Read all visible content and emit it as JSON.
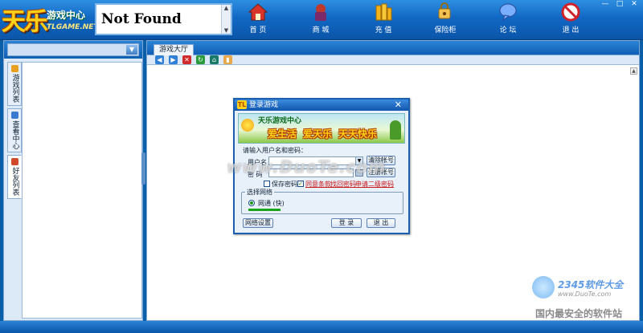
{
  "app": {
    "logo_main": "天乐",
    "logo_sub": "游戏中心",
    "logo_url": "TLGAME.NET",
    "address_text": "Not Found"
  },
  "nav": [
    {
      "key": "home",
      "label": "首 页",
      "icon": "house-icon"
    },
    {
      "key": "mall",
      "label": "商 城",
      "icon": "shopping-bag-icon"
    },
    {
      "key": "recharge",
      "label": "充 值",
      "icon": "coins-icon"
    },
    {
      "key": "safe",
      "label": "保险柜",
      "icon": "safe-lock-icon"
    },
    {
      "key": "forum",
      "label": "论 坛",
      "icon": "chat-bubble-icon"
    },
    {
      "key": "exit",
      "label": "退 出",
      "icon": "no-entry-icon"
    }
  ],
  "window_controls": {
    "minimize": "—",
    "maximize": "□",
    "close": "✕"
  },
  "left_tabs": [
    {
      "label": "游戏列表",
      "color": "#e8a020"
    },
    {
      "label": "查看中心",
      "color": "#3a7ad0"
    },
    {
      "label": "好友列表",
      "color": "#d04a2a"
    }
  ],
  "main": {
    "tab_label": "游戏大厅",
    "toolbar": [
      {
        "name": "back-icon",
        "glyph": "◀",
        "color": "#2f7fd6"
      },
      {
        "name": "forward-icon",
        "glyph": "▶",
        "color": "#2f7fd6"
      },
      {
        "name": "stop-icon",
        "glyph": "✕",
        "color": "#d02a2a"
      },
      {
        "name": "refresh-icon",
        "glyph": "↻",
        "color": "#2a9a3a"
      },
      {
        "name": "home-icon",
        "glyph": "⌂",
        "color": "#1a7a6a"
      },
      {
        "name": "favorites-icon",
        "glyph": "▮",
        "color": "#e8a84a"
      }
    ]
  },
  "dialog": {
    "title": "登录游戏",
    "title_icon": "TL",
    "close": "✕",
    "banner_title": "天乐游戏中心",
    "banner_slogans": [
      "爱生活",
      "爱天乐",
      "天天快乐"
    ],
    "prompt": "请输入用户名和密码：",
    "username_label": "用户名",
    "username_value": "",
    "password_label": "密 码",
    "password_value": "",
    "clear_account_label": "清除帐号",
    "register_label": "注册帐号",
    "save_password_label": "保存密码",
    "save_password_checked": false,
    "agree_terms_label": "同意条款",
    "agree_terms_checked": true,
    "find_password_label": "找回密码",
    "apply_second_password_label": "申请二级密码",
    "network_group_label": "选择网络",
    "network_option": "网通 (快)",
    "network_settings_label": "网络设置",
    "login_label": "登 录",
    "exit_label": "退 出"
  },
  "watermarks": {
    "center": "www.DuoTe.com",
    "corner_brand": "2345软件大全",
    "corner_url": "www.DuoTe.com",
    "corner_slogan": "国内最安全的软件站"
  }
}
